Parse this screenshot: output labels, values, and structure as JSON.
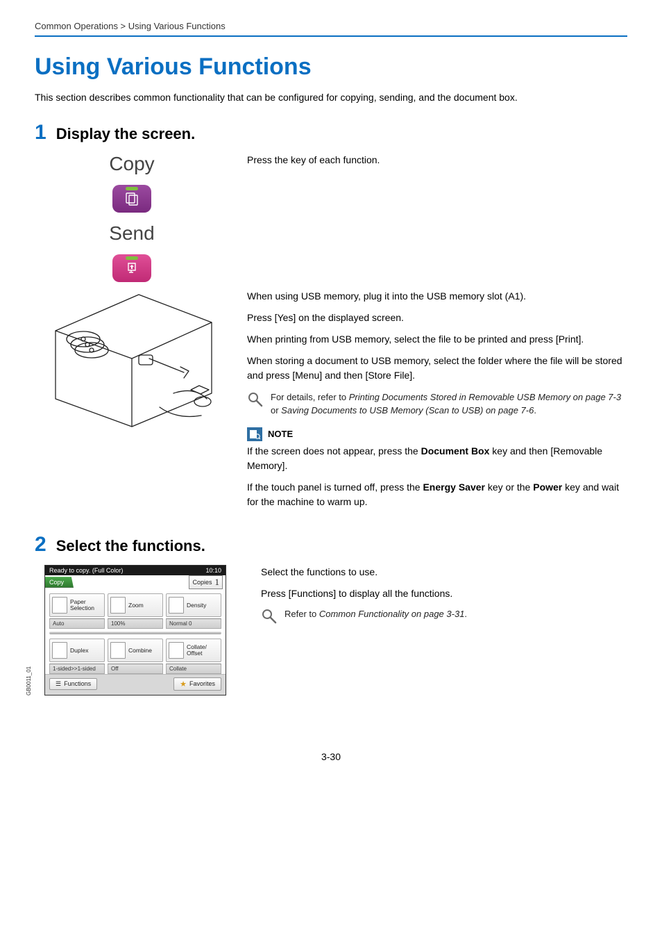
{
  "breadcrumb": "Common Operations > Using Various Functions",
  "heading": "Using Various Functions",
  "intro": "This section describes common functionality that can be configured for copying, sending, and the document box.",
  "step1": {
    "num": "1",
    "title": "Display the screen.",
    "copy_label": "Copy",
    "send_label": "Send",
    "press_key": "Press the key of each function.",
    "usb_plug": "When using USB memory, plug it into the USB memory slot (A1).",
    "press_yes": "Press [Yes] on the displayed screen.",
    "usb_print": "When printing from USB memory, select the file to be printed and press [Print].",
    "usb_store": "When storing a document to USB memory, select the folder where the file will be stored and press [Menu] and then [Store File].",
    "ref_prefix": "For details, refer to ",
    "ref_link1": "Printing Documents Stored in Removable USB Memory on page 7-3",
    "ref_or": " or ",
    "ref_link2": "Saving Documents to USB Memory (Scan to USB) on page 7-6",
    "ref_period": ".",
    "note_label": "NOTE",
    "note1_a": "If the screen does not appear, press the ",
    "note1_b": "Document Box",
    "note1_c": " key and then [Removable Memory].",
    "note2_a": "If the touch panel is turned off, press the ",
    "note2_b": "Energy Saver",
    "note2_c": " key or the ",
    "note2_d": "Power",
    "note2_e": " key and wait for the machine to warm up."
  },
  "step2": {
    "num": "2",
    "title": "Select the functions.",
    "select_text": "Select the functions to use.",
    "press_func": "Press [Functions] to display all the functions.",
    "ref_prefix": "Refer to ",
    "ref_link": "Common Functionality on page 3-31",
    "ref_period": ".",
    "side_label": "GB0011_01",
    "panel": {
      "status": "Ready to copy. (Full Color)",
      "time": "10:10",
      "tab": "Copy",
      "copies_label": "Copies",
      "copies_value": "1",
      "tiles": [
        {
          "label": "Paper Selection",
          "status": "Auto"
        },
        {
          "label": "Zoom",
          "status": "100%"
        },
        {
          "label": "Density",
          "status": "Normal 0"
        },
        {
          "label": "Duplex",
          "status": "1-sided>>1-sided"
        },
        {
          "label": "Combine",
          "status": "Off"
        },
        {
          "label": "Collate/ Offset",
          "status": "Collate"
        }
      ],
      "functions": "Functions",
      "favorites": "Favorites"
    }
  },
  "page_number": "3-30"
}
